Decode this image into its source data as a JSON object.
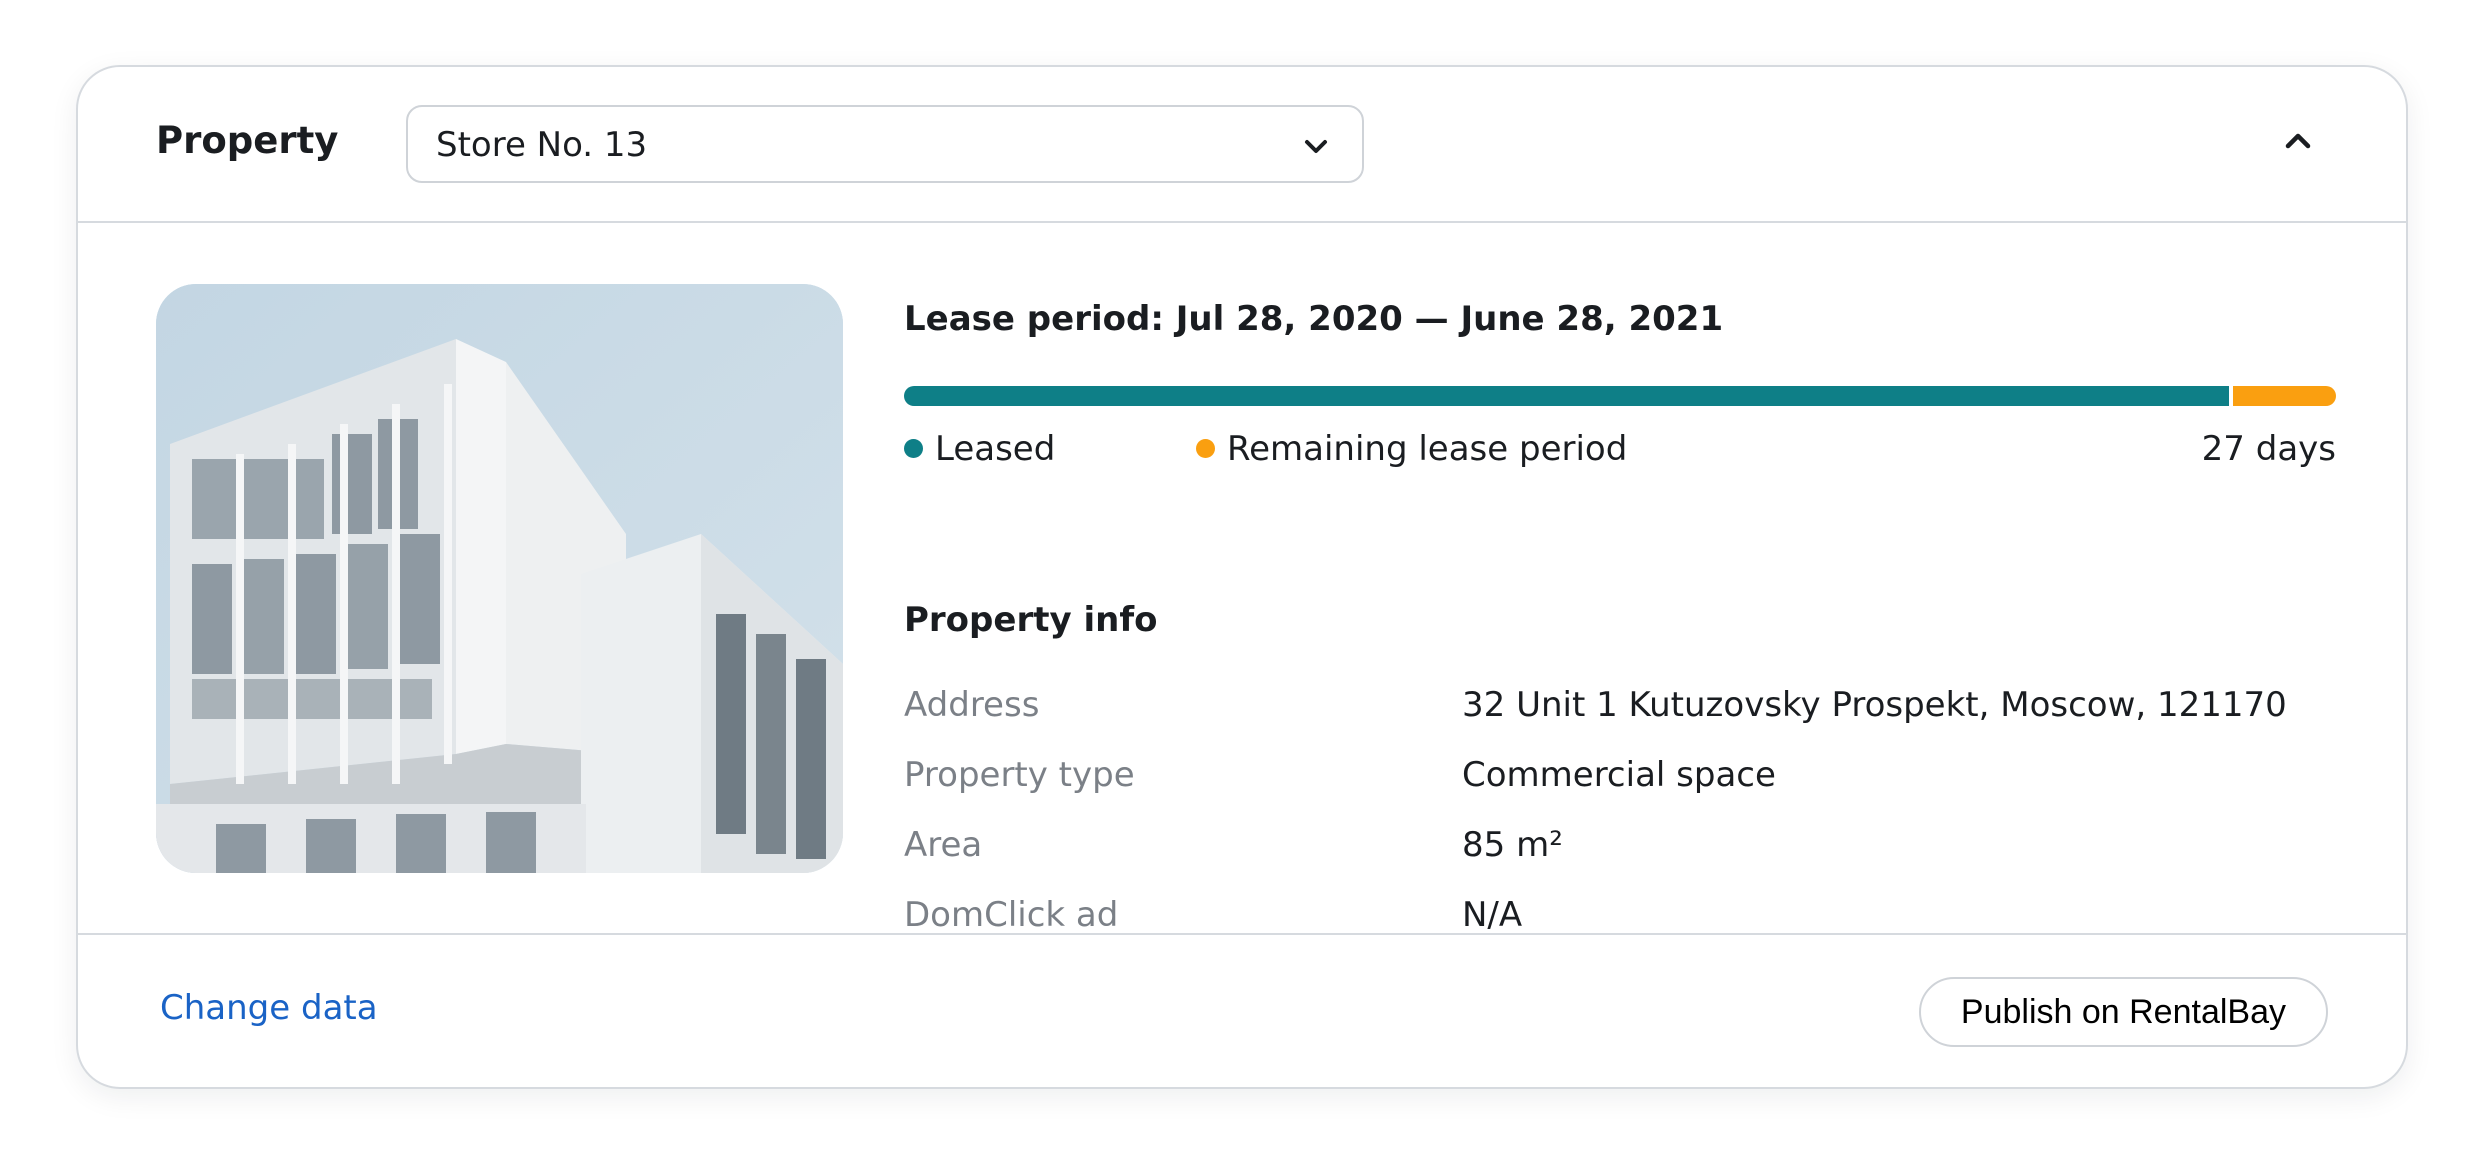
{
  "header": {
    "label": "Property",
    "property_select": {
      "value": "Store No. 13"
    },
    "collapse_icon": "chevron-up-icon"
  },
  "photo": {
    "subject": "white modern building against pale blue sky"
  },
  "lease": {
    "title": "Lease period: Jul 28, 2020 — June 28, 2021",
    "progress_leased_fraction": 0.925,
    "legend": {
      "leased": "Leased",
      "remaining": "Remaining lease period",
      "days_left": "27 days"
    },
    "colors": {
      "leased": "#0e7f87",
      "remaining": "#fa9f10"
    }
  },
  "property_info": {
    "title": "Property info",
    "rows": [
      {
        "label": "Address",
        "value": "32 Unit 1 Kutuzovsky Prospekt, Moscow, 121170"
      },
      {
        "label": "Property type",
        "value": "Commercial space"
      },
      {
        "label": "Area",
        "value": "85 m²"
      },
      {
        "label": "DomClick ad",
        "value": "N/A"
      }
    ]
  },
  "footer": {
    "change_link": "Change data",
    "publish_button": "Publish on RentalBay",
    "link_color": "#1a63c6"
  }
}
